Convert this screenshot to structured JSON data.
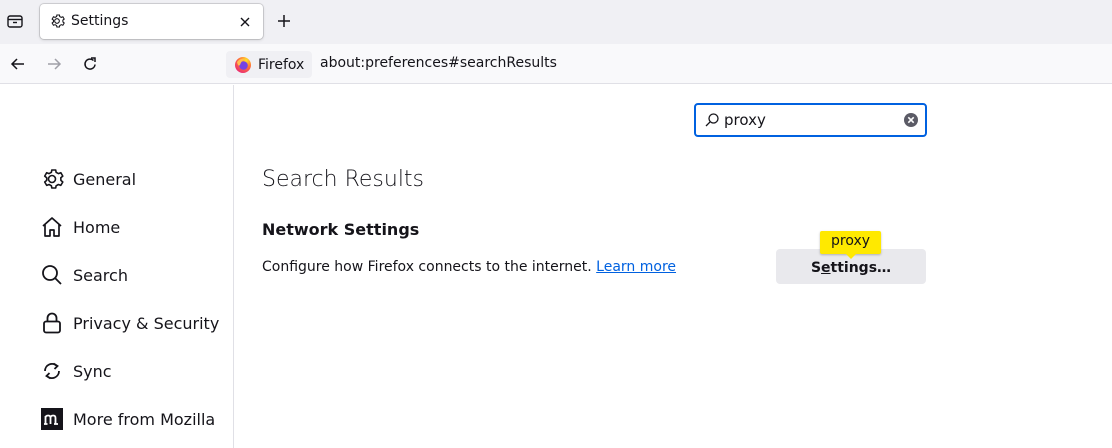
{
  "tabstrip": {
    "tab_title": "Settings",
    "icons": {
      "tab_list": "tab-list-icon",
      "tab": "gear-icon",
      "close": "close-icon",
      "new_tab": "plus-icon"
    }
  },
  "navbar": {
    "identity_label": "Firefox",
    "url": "about:preferences#searchResults",
    "icons": {
      "back": "back-arrow-icon",
      "forward": "forward-arrow-icon",
      "reload": "reload-icon"
    }
  },
  "sidebar": {
    "items": [
      {
        "label": "General",
        "icon": "gear-icon"
      },
      {
        "label": "Home",
        "icon": "home-icon"
      },
      {
        "label": "Search",
        "icon": "search-icon"
      },
      {
        "label": "Privacy & Security",
        "icon": "lock-icon"
      },
      {
        "label": "Sync",
        "icon": "sync-icon"
      },
      {
        "label": "More from Mozilla",
        "icon": "mozilla-icon"
      }
    ]
  },
  "search": {
    "value": "proxy"
  },
  "results": {
    "heading": "Search Results",
    "group_title": "Network Settings",
    "description": "Configure how Firefox connects to the internet.",
    "learn_more": "Learn more",
    "settings_button_pre": "S",
    "settings_button_accesskey": "e",
    "settings_button_post": "ttings…",
    "tooltip": "proxy"
  },
  "colors": {
    "accent": "#0061e0",
    "highlight": "#ffe900",
    "button": "#e9e9ed"
  }
}
